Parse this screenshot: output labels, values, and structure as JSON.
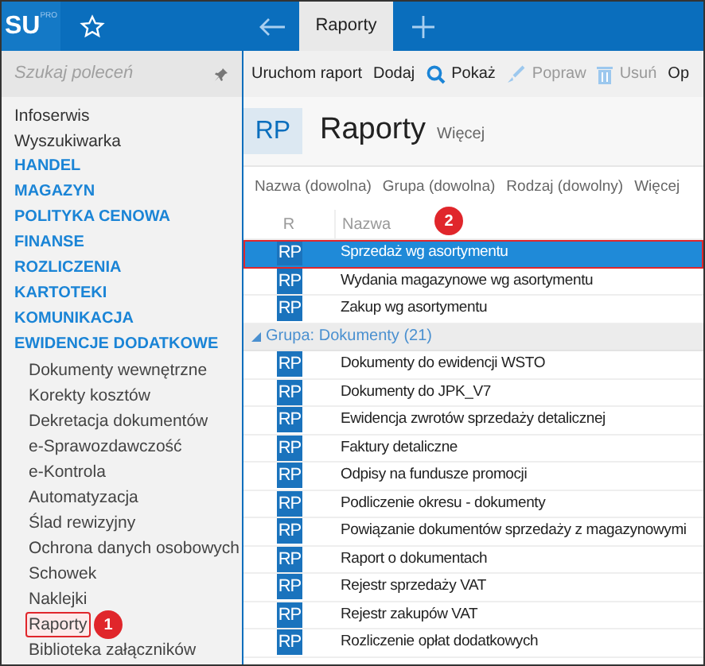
{
  "app": {
    "logo": "SU",
    "logo_sup": "PRO"
  },
  "tabs": [
    {
      "label": "Raporty",
      "selected": true
    }
  ],
  "sidebar": {
    "search": {
      "placeholder": "Szukaj poleceń"
    },
    "items": [
      {
        "label": "Infoserwis",
        "kind": "link",
        "selected": false
      },
      {
        "label": "Wyszukiwarka",
        "kind": "link",
        "selected": false
      },
      {
        "label": "HANDEL",
        "kind": "section",
        "selected": false
      },
      {
        "label": "MAGAZYN",
        "kind": "section",
        "selected": false
      },
      {
        "label": "POLITYKA CENOWA",
        "kind": "section",
        "selected": false
      },
      {
        "label": "FINANSE",
        "kind": "section",
        "selected": false
      },
      {
        "label": "ROZLICZENIA",
        "kind": "section",
        "selected": false
      },
      {
        "label": "KARTOTEKI",
        "kind": "section",
        "selected": false
      },
      {
        "label": "KOMUNIKACJA",
        "kind": "section",
        "selected": false
      },
      {
        "label": "EWIDENCJE DODATKOWE",
        "kind": "section",
        "selected": false
      },
      {
        "label": "Dokumenty wewnętrzne",
        "kind": "subitem",
        "selected": false
      },
      {
        "label": "Korekty kosztów",
        "kind": "subitem",
        "selected": false
      },
      {
        "label": "Dekretacja dokumentów",
        "kind": "subitem",
        "selected": false
      },
      {
        "label": "e-Sprawozdawczość",
        "kind": "subitem",
        "selected": false
      },
      {
        "label": "e-Kontrola",
        "kind": "subitem",
        "selected": false
      },
      {
        "label": "Automatyzacja",
        "kind": "subitem",
        "selected": false
      },
      {
        "label": "Ślad rewizyjny",
        "kind": "subitem",
        "selected": false
      },
      {
        "label": "Ochrona danych osobowych",
        "kind": "subitem",
        "selected": false
      },
      {
        "label": "Schowek",
        "kind": "subitem",
        "selected": false
      },
      {
        "label": "Naklejki",
        "kind": "subitem",
        "selected": false
      },
      {
        "label": "Raporty",
        "kind": "subitem",
        "selected": true,
        "callout": "1"
      },
      {
        "label": "Biblioteka załączników",
        "kind": "subitem",
        "selected": false
      }
    ]
  },
  "toolbar": [
    {
      "label": "Uruchom raport",
      "kind": "plain",
      "disabled": false
    },
    {
      "label": "Dodaj",
      "kind": "plain",
      "disabled": false
    },
    {
      "label": "Pokaż",
      "kind": "search",
      "disabled": false
    },
    {
      "label": "Popraw",
      "kind": "brush",
      "disabled": true
    },
    {
      "label": "Usuń",
      "kind": "trash",
      "disabled": true
    },
    {
      "label": "Op",
      "kind": "plain",
      "disabled": false
    }
  ],
  "header": {
    "badge": "RP",
    "title": "Raporty",
    "more": "Więcej"
  },
  "filters": [
    "Nazwa (dowolna)",
    "Grupa (dowolna)",
    "Rodzaj (dowolny)",
    "Więcej"
  ],
  "table": {
    "columns": [
      "R",
      "Nazwa"
    ],
    "rows": [
      {
        "kind": "report",
        "badge": "RP",
        "name": "Sprzedaż wg asortymentu",
        "selected": true,
        "callout": "2"
      },
      {
        "kind": "report",
        "badge": "RP",
        "name": "Wydania magazynowe wg asortymentu",
        "selected": false
      },
      {
        "kind": "report",
        "badge": "RP",
        "name": "Zakup wg asortymentu",
        "selected": false
      },
      {
        "kind": "group",
        "name": "Grupa: Dokumenty (21)",
        "expanded": true
      },
      {
        "kind": "report",
        "badge": "RP",
        "name": "Dokumenty do ewidencji WSTO",
        "selected": false
      },
      {
        "kind": "report",
        "badge": "RP",
        "name": "Dokumenty do JPK_V7",
        "selected": false
      },
      {
        "kind": "report",
        "badge": "RP",
        "name": "Ewidencja zwrotów sprzedaży detalicznej",
        "selected": false
      },
      {
        "kind": "report",
        "badge": "RP",
        "name": "Faktury detaliczne",
        "selected": false
      },
      {
        "kind": "report",
        "badge": "RP",
        "name": "Odpisy na fundusze promocji",
        "selected": false
      },
      {
        "kind": "report",
        "badge": "RP",
        "name": "Podliczenie okresu - dokumenty",
        "selected": false
      },
      {
        "kind": "report",
        "badge": "RP",
        "name": "Powiązanie dokumentów sprzedaży z magazynowymi",
        "selected": false
      },
      {
        "kind": "report",
        "badge": "RP",
        "name": "Raport o dokumentach",
        "selected": false
      },
      {
        "kind": "report",
        "badge": "RP",
        "name": "Rejestr sprzedaży VAT",
        "selected": false
      },
      {
        "kind": "report",
        "badge": "RP",
        "name": "Rejestr zakupów VAT",
        "selected": false
      },
      {
        "kind": "report",
        "badge": "RP",
        "name": "Rozliczenie opłat dodatkowych",
        "selected": false
      }
    ]
  }
}
